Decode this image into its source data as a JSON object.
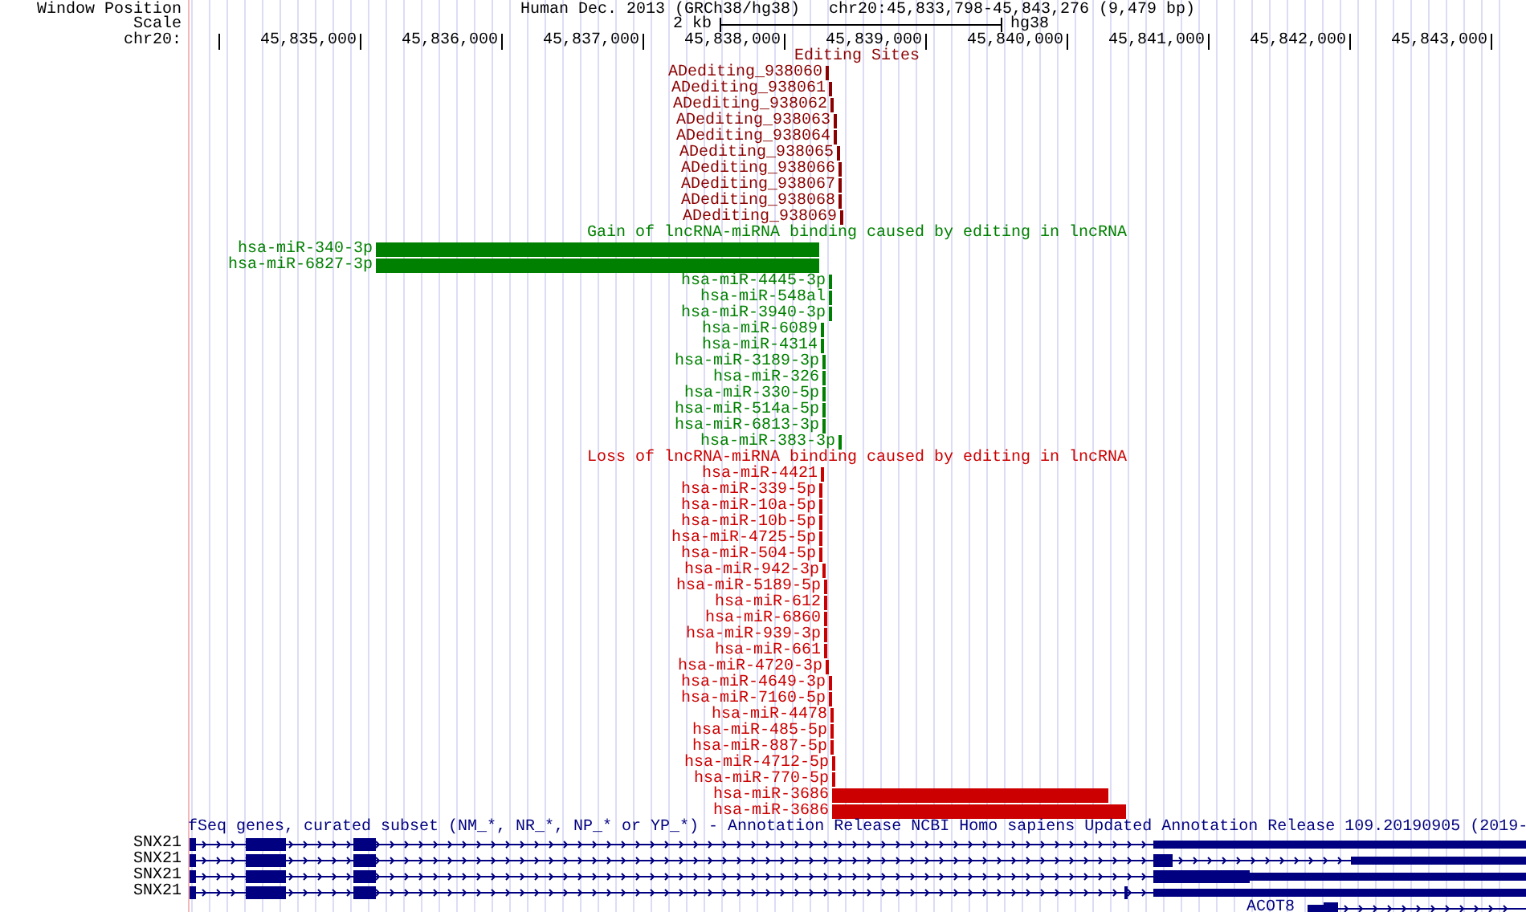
{
  "header": {
    "window_position_label": "Window Position",
    "assembly": "Human Dec. 2013 (GRCh38/hg38)",
    "position": "chr20:45,833,798-45,843,276 (9,479 bp)",
    "scale_label": "Scale",
    "scale_value": "2 kb",
    "scale_assembly": "hg38",
    "chrom_label": "chr20:"
  },
  "ruler_ticks": [
    "45,835,000",
    "45,836,000",
    "45,837,000",
    "45,838,000",
    "45,839,000",
    "45,840,000",
    "45,841,000",
    "45,842,000",
    "45,843,000"
  ],
  "tracks": [
    {
      "kind": "features",
      "title": "Editing Sites",
      "color": "#8b0000",
      "items": [
        {
          "label": "ADediting_938060"
        },
        {
          "label": "ADediting_938061"
        },
        {
          "label": "ADediting_938062"
        },
        {
          "label": "ADediting_938063"
        },
        {
          "label": "ADediting_938064"
        },
        {
          "label": "ADediting_938065"
        },
        {
          "label": "ADediting_938066"
        },
        {
          "label": "ADediting_938067"
        },
        {
          "label": "ADediting_938068"
        },
        {
          "label": "ADediting_938069"
        }
      ]
    },
    {
      "kind": "features",
      "title": "Gain of lncRNA-miRNA binding caused by editing in lncRNA",
      "color": "#008000",
      "items": [
        {
          "label": "hsa-miR-340-3p"
        },
        {
          "label": "hsa-miR-6827-3p"
        },
        {
          "label": "hsa-miR-4445-3p"
        },
        {
          "label": "hsa-miR-548al"
        },
        {
          "label": "hsa-miR-3940-3p"
        },
        {
          "label": "hsa-miR-6089"
        },
        {
          "label": "hsa-miR-4314"
        },
        {
          "label": "hsa-miR-3189-3p"
        },
        {
          "label": "hsa-miR-326"
        },
        {
          "label": "hsa-miR-330-5p"
        },
        {
          "label": "hsa-miR-514a-5p"
        },
        {
          "label": "hsa-miR-6813-3p"
        },
        {
          "label": "hsa-miR-383-3p"
        }
      ]
    },
    {
      "kind": "features",
      "title": "Loss of lncRNA-miRNA binding caused by editing in lncRNA",
      "color": "#cc0000",
      "items": [
        {
          "label": "hsa-miR-4421"
        },
        {
          "label": "hsa-miR-339-5p"
        },
        {
          "label": "hsa-miR-10a-5p"
        },
        {
          "label": "hsa-miR-10b-5p"
        },
        {
          "label": "hsa-miR-4725-5p"
        },
        {
          "label": "hsa-miR-504-5p"
        },
        {
          "label": "hsa-miR-942-3p"
        },
        {
          "label": "hsa-miR-5189-5p"
        },
        {
          "label": "hsa-miR-612"
        },
        {
          "label": "hsa-miR-6860"
        },
        {
          "label": "hsa-miR-939-3p"
        },
        {
          "label": "hsa-miR-661"
        },
        {
          "label": "hsa-miR-4720-3p"
        },
        {
          "label": "hsa-miR-4649-3p"
        },
        {
          "label": "hsa-miR-7160-5p"
        },
        {
          "label": "hsa-miR-4478"
        },
        {
          "label": "hsa-miR-485-5p"
        },
        {
          "label": "hsa-miR-887-5p"
        },
        {
          "label": "hsa-miR-4712-5p"
        },
        {
          "label": "hsa-miR-770-5p"
        },
        {
          "label": "hsa-miR-3686"
        },
        {
          "label": "hsa-miR-3686"
        }
      ]
    },
    {
      "kind": "genes",
      "title": "fSeq genes, curated subset (NM_*, NR_*, NP_* or YP_*) - Annotation Release NCBI Homo sapiens Updated Annotation Release 109.20190905 (2019-",
      "color": "#000080",
      "items": [
        {
          "label": "SNX21"
        },
        {
          "label": "SNX21"
        },
        {
          "label": "SNX21"
        },
        {
          "label": "SNX21"
        },
        {
          "label": "ACOT8"
        }
      ]
    }
  ]
}
